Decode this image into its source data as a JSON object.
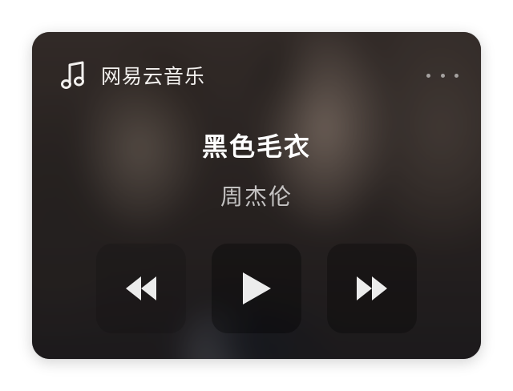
{
  "widget": {
    "app_name": "网易云音乐",
    "app_icon": "music-note-icon",
    "menu_icon": "more-dots-icon"
  },
  "track": {
    "title": "黑色毛衣",
    "artist": "周杰伦"
  },
  "controls": {
    "previous_icon": "rewind-icon",
    "play_icon": "play-icon",
    "next_icon": "fast-forward-icon"
  },
  "colors": {
    "text_primary": "#ffffff",
    "text_secondary": "#c9c5c2",
    "control_glyph": "#ececec"
  }
}
